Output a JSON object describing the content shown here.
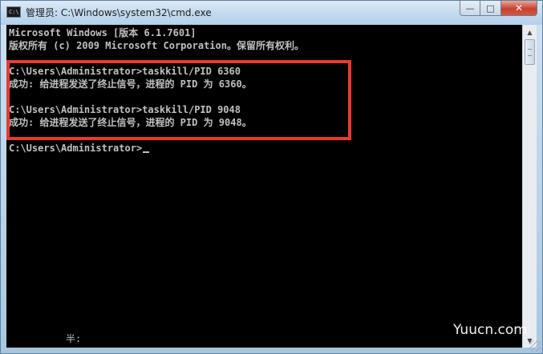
{
  "window": {
    "icon_label": "C:\\",
    "title": "管理员: C:\\Windows\\system32\\cmd.exe",
    "buttons": {
      "minimize": "—",
      "maximize": "□",
      "close": "✕"
    }
  },
  "console": {
    "lines": [
      "Microsoft Windows [版本 6.1.7601]",
      "版权所有 (c) 2009 Microsoft Corporation。保留所有权利。",
      "",
      "C:\\Users\\Administrator>taskkill/PID 6360",
      "成功: 给进程发送了终止信号，进程的 PID 为 6360。",
      "",
      "C:\\Users\\Administrator>taskkill/PID 9048",
      "成功: 给进程发送了终止信号，进程的 PID 为 9048。",
      "",
      "C:\\Users\\Administrator>"
    ],
    "ime_status": "半:"
  },
  "scrollbar": {
    "up_arrow": "▲",
    "down_arrow": "▼"
  },
  "watermark": "Yuucn.com",
  "colors": {
    "console_bg": "#000000",
    "console_text": "#c0c0c0",
    "highlight_border": "#e63b35",
    "close_button": "#c7402f"
  }
}
